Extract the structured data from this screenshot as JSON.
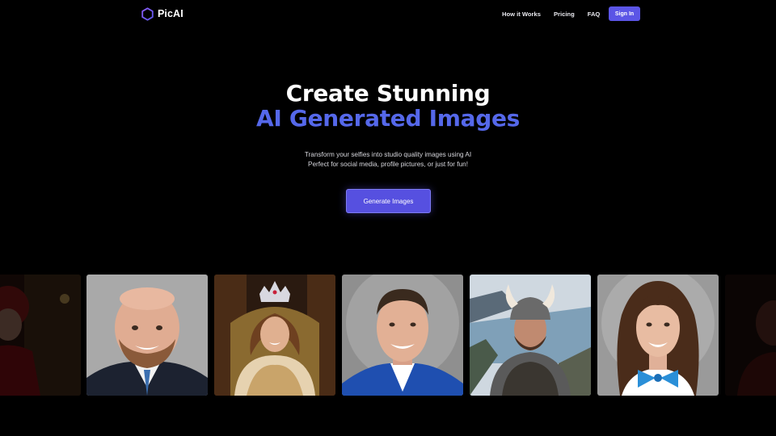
{
  "brand": {
    "name": "PicAI",
    "logo_icon": "hexagon-ring-icon",
    "accent": "#5b55e6"
  },
  "nav": {
    "links": [
      "How it Works",
      "Pricing",
      "FAQ"
    ],
    "signin_label": "Sign In"
  },
  "hero": {
    "title_line1": "Create Stunning",
    "title_line2": "AI Generated Images",
    "title_line2_color": "#5568ea",
    "subtitle_line1": "Transform your selfies into studio quality images using AI",
    "subtitle_line2": "Perfect for social media, profile pictures, or just for fun!",
    "cta_label": "Generate Images"
  },
  "gallery": {
    "images": [
      "portrait-red-costume",
      "portrait-man-suit",
      "portrait-queen-crown",
      "portrait-man-blue-suit",
      "portrait-viking-helmet",
      "portrait-woman-blue-bow",
      "portrait-dark-red"
    ]
  }
}
